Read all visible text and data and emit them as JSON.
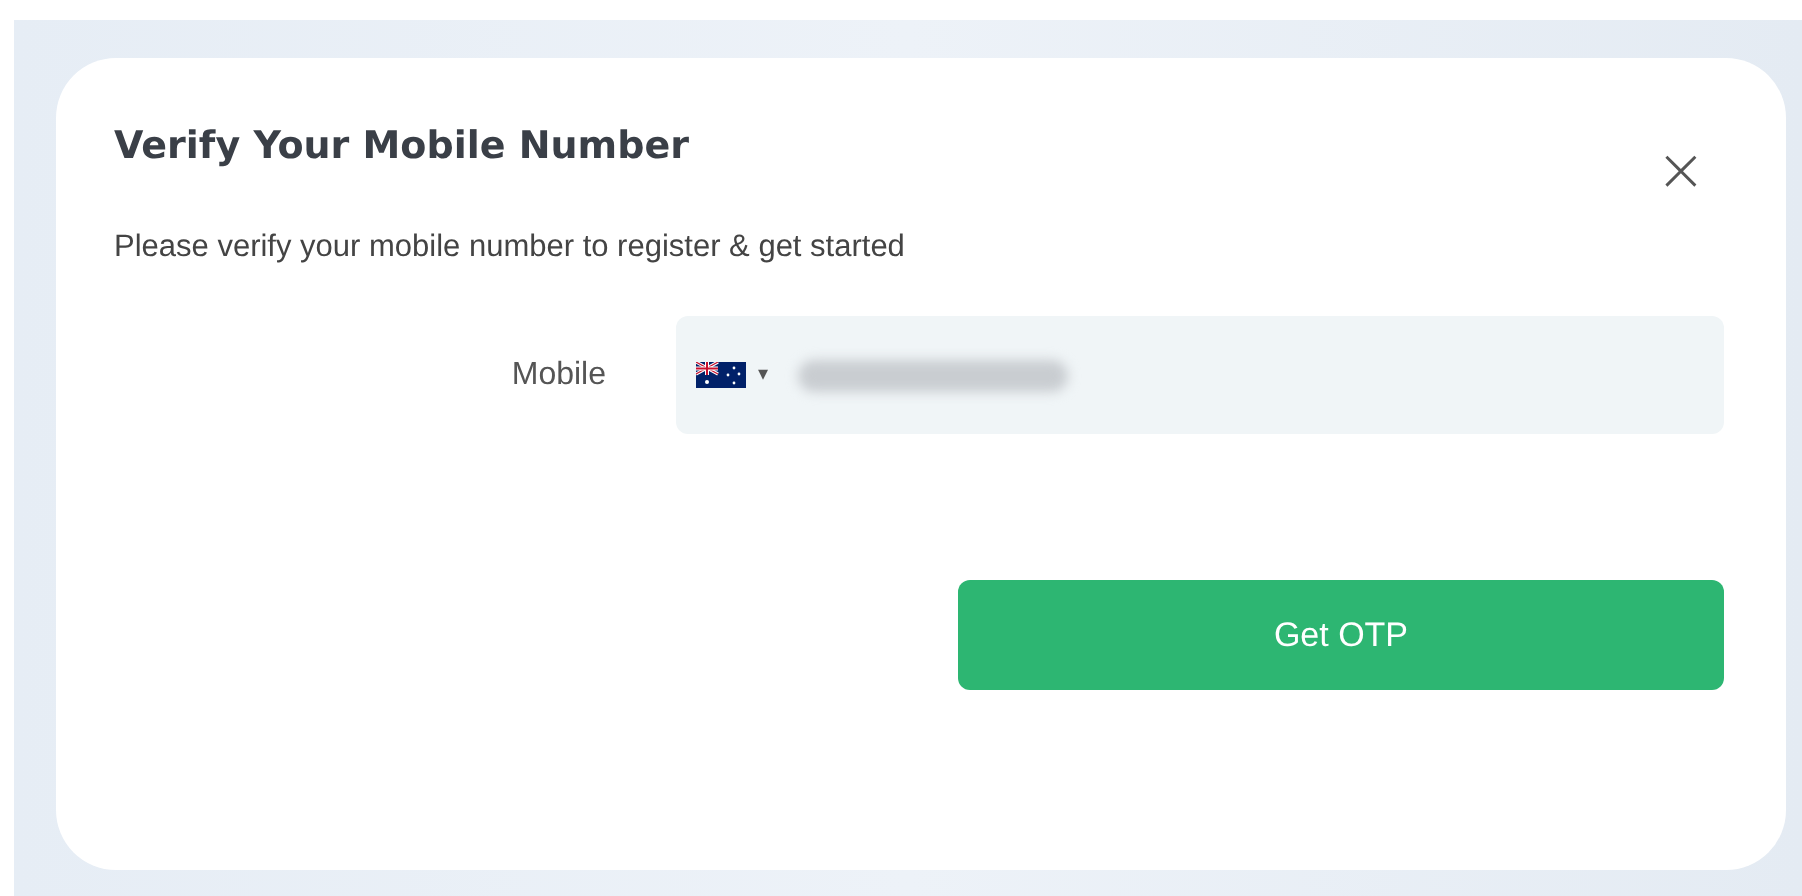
{
  "dialog": {
    "title": "Verify Your Mobile Number",
    "close": "×",
    "message": "Please verify your mobile number to register & get started"
  },
  "mobile": {
    "label": "Mobile",
    "country_caret": "▾"
  },
  "buttons": [
    {
      "label": "Get OTP",
      "kind": "primary"
    }
  ]
}
